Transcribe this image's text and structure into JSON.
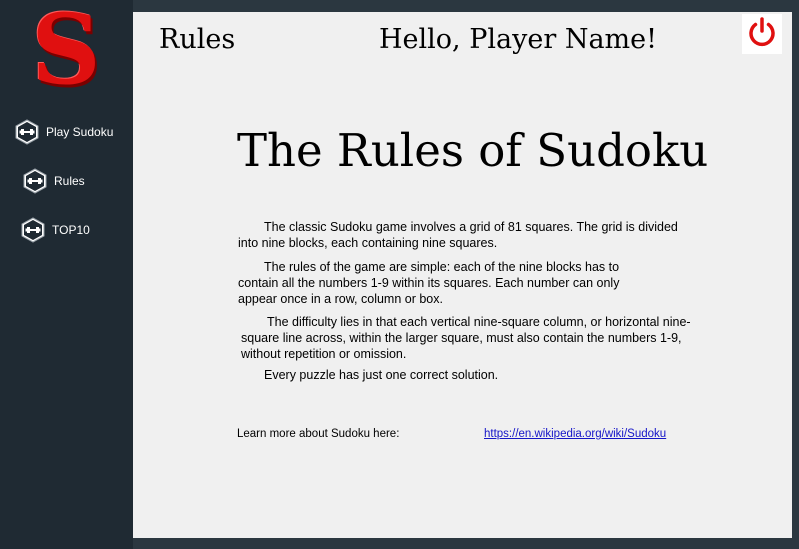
{
  "sidebar": {
    "logo_letter": "S",
    "items": [
      {
        "label": "Play Sudoku",
        "icon": "dumbbell-hexagon-icon"
      },
      {
        "label": "Rules",
        "icon": "dumbbell-hexagon-icon"
      },
      {
        "label": "TOP10",
        "icon": "dumbbell-hexagon-icon"
      }
    ]
  },
  "header": {
    "title": "Rules",
    "greeting": "Hello, Player Name!",
    "power_icon": "power-icon"
  },
  "content": {
    "heading": "The Rules of Sudoku",
    "paragraphs": [
      "The classic Sudoku game involves a grid of 81 squares. The grid is divided into nine blocks, each containing nine squares.",
      "The rules of the game are simple: each of the nine blocks has to contain all the numbers 1-9 within its squares. Each number can only appear once in a row, column or box.",
      "The difficulty lies in that each vertical nine-square column, or horizontal nine-square line across, within the larger square, must also contain the numbers 1-9, without repetition or omission.",
      "Every puzzle has just one correct solution."
    ],
    "learn_more_label": "Learn more about Sudoku here:",
    "learn_more_link": "https://en.wikipedia.org/wiki/Sudoku"
  },
  "colors": {
    "sidebar_bg": "#1f2a33",
    "main_bg": "#f0f0f0",
    "accent_red": "#e01010",
    "link": "#1515c8"
  }
}
